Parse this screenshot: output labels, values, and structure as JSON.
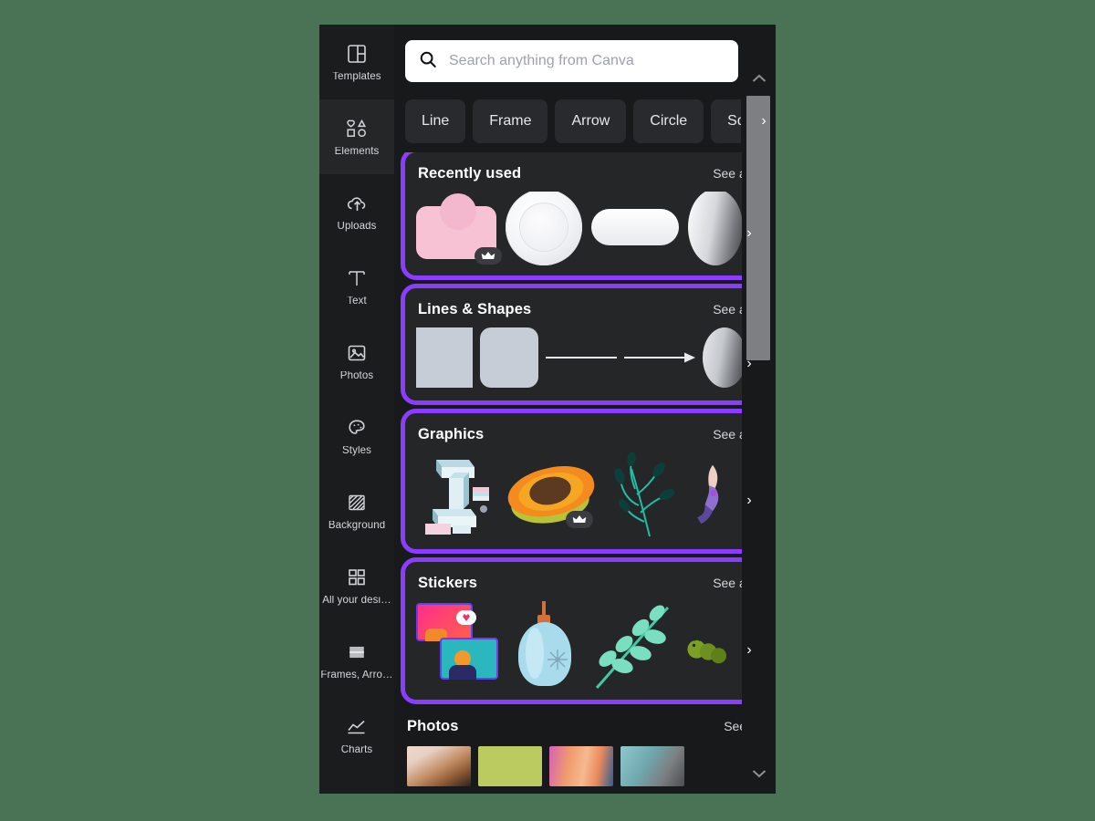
{
  "app": {
    "name": "Canva",
    "background_color": "#4a7355",
    "panel_background": "#18191b",
    "highlight_color": "#8b3dff"
  },
  "sidebar": {
    "items": [
      {
        "label": "Templates",
        "icon": "templates-icon",
        "active": false
      },
      {
        "label": "Elements",
        "icon": "elements-icon",
        "active": true
      },
      {
        "label": "Uploads",
        "icon": "uploads-icon",
        "active": false
      },
      {
        "label": "Text",
        "icon": "text-icon",
        "active": false
      },
      {
        "label": "Photos",
        "icon": "photos-icon",
        "active": false
      },
      {
        "label": "Styles",
        "icon": "styles-icon",
        "active": false
      },
      {
        "label": "Background",
        "icon": "background-icon",
        "active": false
      },
      {
        "label": "All your desi…",
        "icon": "all-designs-icon",
        "active": false
      },
      {
        "label": "Frames, Arro…",
        "icon": "frames-icon",
        "active": false
      },
      {
        "label": "Charts",
        "icon": "charts-icon",
        "active": false
      }
    ]
  },
  "search": {
    "placeholder": "Search anything from Canva",
    "value": "",
    "icon": "search-icon"
  },
  "chips": [
    {
      "label": "Line"
    },
    {
      "label": "Frame"
    },
    {
      "label": "Arrow"
    },
    {
      "label": "Circle"
    },
    {
      "label": "Squa"
    }
  ],
  "chips_next_label": "›",
  "sections": [
    {
      "title": "Recently used",
      "see_all": "See all",
      "highlighted": true,
      "next_label": "›",
      "items": [
        {
          "name": "pink-rounded-rectangle-shape",
          "pro": true
        },
        {
          "name": "white-plate-photo",
          "pro": false
        },
        {
          "name": "white-pill-shape",
          "pro": false
        },
        {
          "name": "gray-gradient-circle",
          "pro": false
        }
      ]
    },
    {
      "title": "Lines & Shapes",
      "see_all": "See all",
      "highlighted": true,
      "next_label": "›",
      "items": [
        {
          "name": "square-shape",
          "pro": false
        },
        {
          "name": "rounded-square-shape",
          "pro": false
        },
        {
          "name": "line-shape",
          "pro": false
        },
        {
          "name": "arrow-shape",
          "pro": false
        },
        {
          "name": "gradient-circle-shape",
          "pro": false
        }
      ]
    },
    {
      "title": "Graphics",
      "see_all": "See all",
      "highlighted": true,
      "next_label": "›",
      "items": [
        {
          "name": "isometric-letter-i-graphic",
          "pro": false
        },
        {
          "name": "papaya-fruit-graphic",
          "pro": true
        },
        {
          "name": "teal-seaweed-branch-graphic",
          "pro": false
        },
        {
          "name": "figure-graphic",
          "pro": false
        }
      ]
    },
    {
      "title": "Stickers",
      "see_all": "See all",
      "highlighted": true,
      "next_label": "›",
      "items": [
        {
          "name": "social-media-cards-sticker",
          "pro": false
        },
        {
          "name": "blue-ornament-sticker",
          "pro": false
        },
        {
          "name": "green-leaf-branch-sticker",
          "pro": false
        },
        {
          "name": "green-caterpillar-sticker",
          "pro": false
        }
      ]
    }
  ],
  "photos_section": {
    "title": "Photos",
    "see_all": "See all",
    "items": [
      {
        "name": "hands-fabric-photo"
      },
      {
        "name": "olive-green-photo"
      },
      {
        "name": "pink-orange-flower-photo"
      },
      {
        "name": "teal-abstract-photo"
      }
    ]
  },
  "scrollbars": {
    "panel_up_icon": "chevron-up-icon",
    "panel_down_icon": "chevron-down-icon"
  }
}
